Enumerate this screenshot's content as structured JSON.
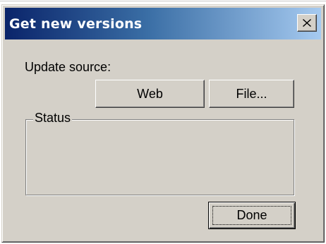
{
  "window": {
    "title": "Get new versions"
  },
  "titlebar_buttons": {
    "close_icon": "close-icon"
  },
  "content": {
    "update_source_label": "Update source:",
    "web_button_label": "Web",
    "file_button_label": "File...",
    "status_group_label": "Status",
    "status_text": "",
    "done_button_label": "Done"
  },
  "colors": {
    "titlebar_start": "#0a246a",
    "titlebar_end": "#a6caf0",
    "face": "#d4d0c8",
    "title_text": "#ffffff"
  }
}
